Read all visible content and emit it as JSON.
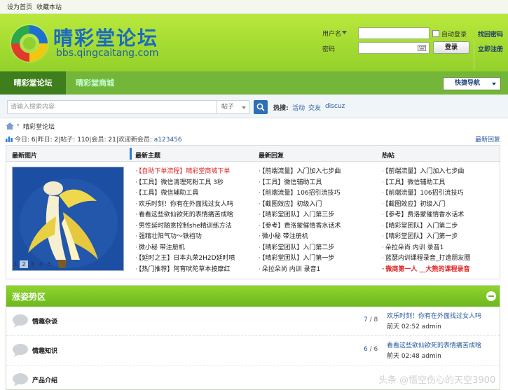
{
  "topbar": {
    "set_home": "设为首页",
    "bookmark": "收藏本站"
  },
  "logo": {
    "title": "晴彩堂论坛",
    "url": "bbs.qingcaitang.com"
  },
  "login": {
    "username_label": "用户名",
    "password_label": "密码",
    "auto_login_label": "自动登录",
    "login_button": "登录",
    "forgot_password": "找回密码",
    "register": "立即注册"
  },
  "nav": {
    "active": "晴彩堂论坛",
    "shop": "晴彩堂商城",
    "quick_nav": "快捷导航"
  },
  "search": {
    "placeholder": "请输入搜索内容",
    "type": "帖子",
    "hot_label": "热搜:",
    "hot_terms": [
      "活动",
      "交友",
      "discuz"
    ]
  },
  "breadcrumb": {
    "forum": "晴彩堂论坛"
  },
  "stats": {
    "today_label": "今日:",
    "today": "6",
    "yesterday_label": "昨日:",
    "yesterday": "2",
    "posts_label": "帖子:",
    "posts": "110",
    "members_label": "会员:",
    "members": "21",
    "welcome_label": "欢迎新会员:",
    "new_member": "a123456",
    "latest_reply": "最新回复"
  },
  "featured": {
    "image_title": "最新图片",
    "topics_title": "最新主题",
    "replies_title": "最新回复",
    "hot_title": "热帖",
    "pager": [
      "1",
      "2",
      "3",
      "4",
      "5"
    ],
    "topics": [
      "【自助下单流程】晴彩堂商城下单",
      "【工具】微信清理死粉工具 3秒",
      "【工具】微信辅助工具",
      "欢乐时刻！你有在外面找过女人吗",
      "看看这些欲仙欲死的表情痛苦成啥",
      "男性延时随意控制she精训练方法",
      "强精壮阳气功～铁裆功",
      "微小秘 带注册机",
      "【延时之王】日本丸荣2H2D延时喷",
      "【热门推荐】阿育吠陀草本按摩红"
    ],
    "replies": [
      "【前端流量】入门加入七步曲",
      "【工具】微信辅助工具",
      "【前端流量】106招引流技巧",
      "【截图效应】初级入门",
      "【晴彩堂团队】入门第三步",
      "【参考】费洛蒙催情香水话术",
      "微小秘 带注册机",
      "【晴彩堂团队】入门第二步",
      "【晴彩堂团队】入门第一步",
      "朵拉朵尚 内训 录音1"
    ],
    "hot": [
      "【前端流量】入门加入七步曲",
      "【工具】微信辅助工具",
      "【前端流量】106招引流技巧",
      "【截图效应】初级入门",
      "【参考】费洛蒙催情香水话术",
      "【晴彩堂团队】入门第二步",
      "【晴彩堂团队】入门第一步",
      "朵拉朵尚 内训 录音1",
      "蓝瑟内训课程录音_打造朋友圈",
      "微商第一人 __大熊的课程录音"
    ]
  },
  "section": {
    "title": "涨姿势区",
    "forums": [
      {
        "name": "情趣杂谈",
        "count_a": "7",
        "count_b": "8",
        "last_title": "欢乐时刻！你有在外面找过女人吗",
        "last_time": "前天 02:52",
        "last_user": "admin"
      },
      {
        "name": "情趣知识",
        "count_a": "6",
        "count_b": "6",
        "last_title": "看看这些欲仙欲死的表情痛苦成啥",
        "last_time": "前天 02:48",
        "last_user": "admin"
      },
      {
        "name": "产品介绍",
        "count_a": "",
        "count_b": "",
        "last_title": "",
        "last_time": "",
        "last_user": ""
      }
    ]
  },
  "watermark": "头条 @悟空伤心的天空3900"
}
